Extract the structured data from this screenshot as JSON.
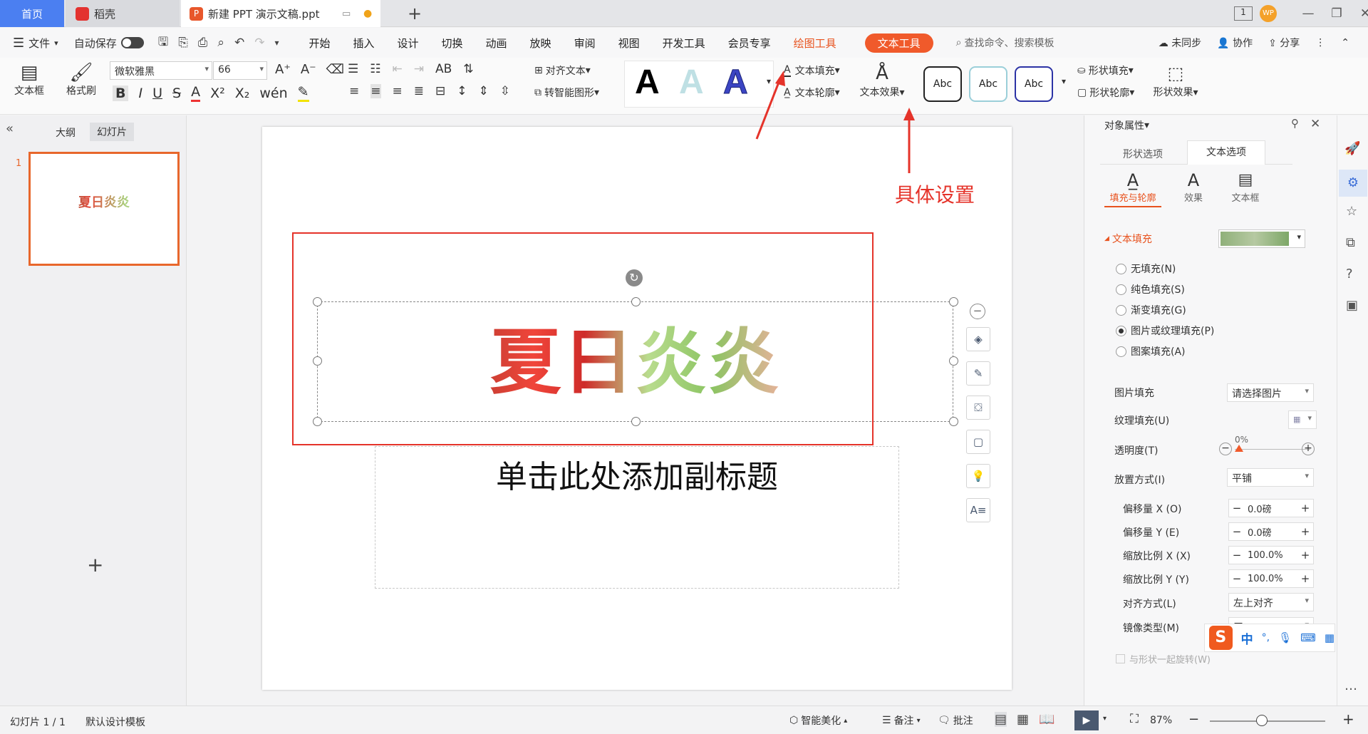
{
  "tabs": {
    "home": "首页",
    "daoke": "稻壳",
    "doc": "新建 PPT 演示文稿.ppt",
    "add": "+"
  },
  "menu": {
    "file": "文件",
    "autosave": "自动保存",
    "items": [
      "开始",
      "插入",
      "设计",
      "切换",
      "动画",
      "放映",
      "审阅",
      "视图",
      "开发工具",
      "会员专享"
    ],
    "draw_tool": "绘图工具",
    "text_tool": "文本工具",
    "search": "查找命令、搜索模板",
    "unsync": "未同步",
    "collab": "协作",
    "share": "分享"
  },
  "ribbon": {
    "textbox": "文本框",
    "format_painter": "格式刷",
    "font": "微软雅黑",
    "size": "66",
    "align_text": "对齐文本",
    "smart_shape": "转智能图形",
    "text_fill": "文本填充",
    "text_outline": "文本轮廓",
    "text_effect": "文本效果",
    "shape_fill": "形状填充",
    "shape_outline": "形状轮廓",
    "shape_effect": "形状效果",
    "abc": "Abc",
    "sample_a": "A"
  },
  "left": {
    "outline_tab": "大纲",
    "slides_tab": "幻灯片",
    "slide_num": "1",
    "thumb_title": "夏日炎炎"
  },
  "slide": {
    "title": "夏日炎炎",
    "subtitle": "单击此处添加副标题"
  },
  "annotation": {
    "label": "具体设置"
  },
  "panel": {
    "title": "对象属性",
    "tab_shape": "形状选项",
    "tab_text": "文本选项",
    "sub_fill": "填充与轮廓",
    "sub_effect": "效果",
    "sub_box": "文本框",
    "section": "文本填充",
    "opts": [
      "无填充(N)",
      "纯色填充(S)",
      "渐变填充(G)",
      "图片或纹理填充(P)",
      "图案填充(A)"
    ],
    "selected_opt": "图片或纹理填充(P)",
    "pic_fill_label": "图片填充",
    "pic_fill_value": "请选择图片",
    "texture_label": "纹理填充(U)",
    "transparency_label": "透明度(T)",
    "transparency_value": "0%",
    "placement_label": "放置方式(I)",
    "placement_value": "平铺",
    "offx_label": "偏移量 X (O)",
    "offx_value": "0.0磅",
    "offy_label": "偏移量 Y (E)",
    "offy_value": "0.0磅",
    "scalex_label": "缩放比例 X (X)",
    "scalex_value": "100.0%",
    "scaley_label": "缩放比例 Y (Y)",
    "scaley_value": "100.0%",
    "align_label": "对齐方式(L)",
    "align_value": "左上对齐",
    "mirror_label": "镜像类型(M)",
    "mirror_value": "无",
    "rotate_label": "与形状一起旋转(W)"
  },
  "ime": {
    "lang": "中",
    "punct": "°,"
  },
  "status": {
    "slide": "幻灯片 1 / 1",
    "template": "默认设计模板",
    "beautify": "智能美化",
    "notes": "备注",
    "comments": "批注",
    "zoom": "87%"
  },
  "colors": {
    "accent": "#f05a2b",
    "tab_blue": "#4b7ff1",
    "annot_red": "#e5332a"
  }
}
